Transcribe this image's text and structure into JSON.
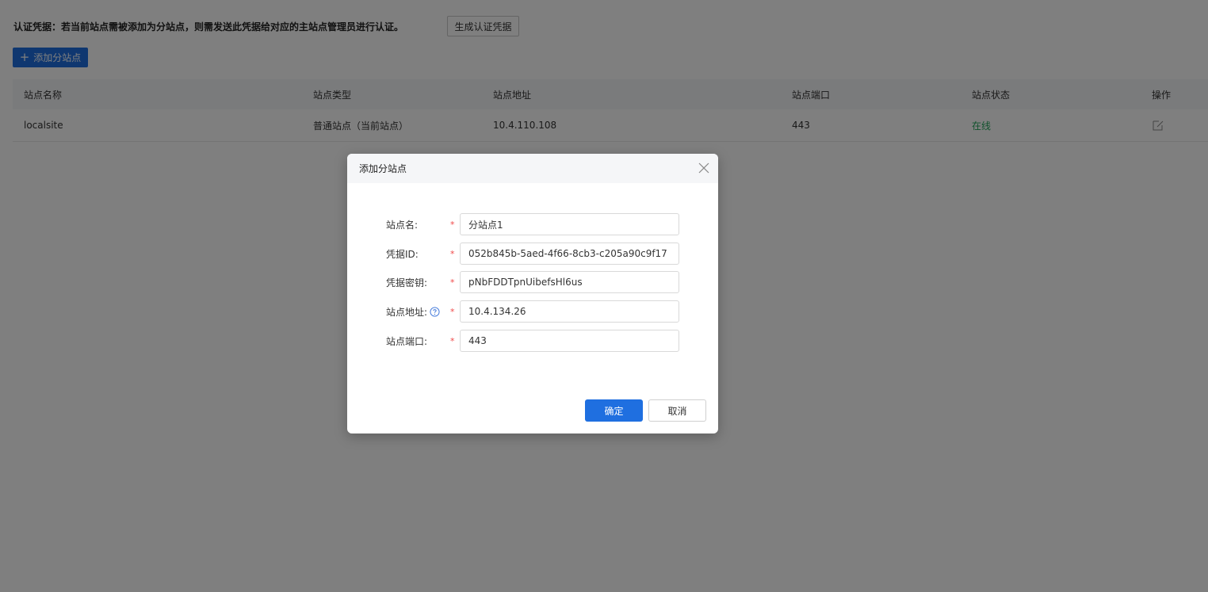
{
  "header": {
    "credential_notice": "认证凭据：若当前站点需被添加为分站点，则需发送此凭据给对应的主站点管理员进行认证。",
    "generate_button": "生成认证凭据",
    "add_site_button": "添加分站点",
    "add_site_icon": "plus-icon"
  },
  "table": {
    "columns": [
      "站点名称",
      "站点类型",
      "站点地址",
      "站点端口",
      "站点状态",
      "操作"
    ],
    "rows": [
      {
        "name": "localsite",
        "type": "普通站点（当前站点）",
        "address": "10.4.110.108",
        "port": "443",
        "status": "在线",
        "action_icon": "edit-icon"
      }
    ]
  },
  "dialog": {
    "title": "添加分站点",
    "close_icon": "close-icon",
    "fields": [
      {
        "label": "站点名:",
        "value": "分站点1",
        "required": true
      },
      {
        "label": "凭据ID:",
        "value": "052b845b-5aed-4f66-8cb3-c205a90c9f17",
        "required": true
      },
      {
        "label": "凭据密钥:",
        "value": "pNbFDDTpnUibefsHl6us",
        "required": true
      },
      {
        "label": "站点地址:",
        "value": "10.4.134.26",
        "required": true,
        "help_icon": "question-circle-icon"
      },
      {
        "label": "站点端口:",
        "value": "443",
        "required": true
      }
    ],
    "required_mark": "*",
    "confirm_button": "确定",
    "cancel_button": "取消"
  },
  "colors": {
    "primary": "#1f6fe0",
    "online": "#22a55a",
    "required": "#f04848",
    "overlay": "rgba(0,0,0,0.5)"
  }
}
